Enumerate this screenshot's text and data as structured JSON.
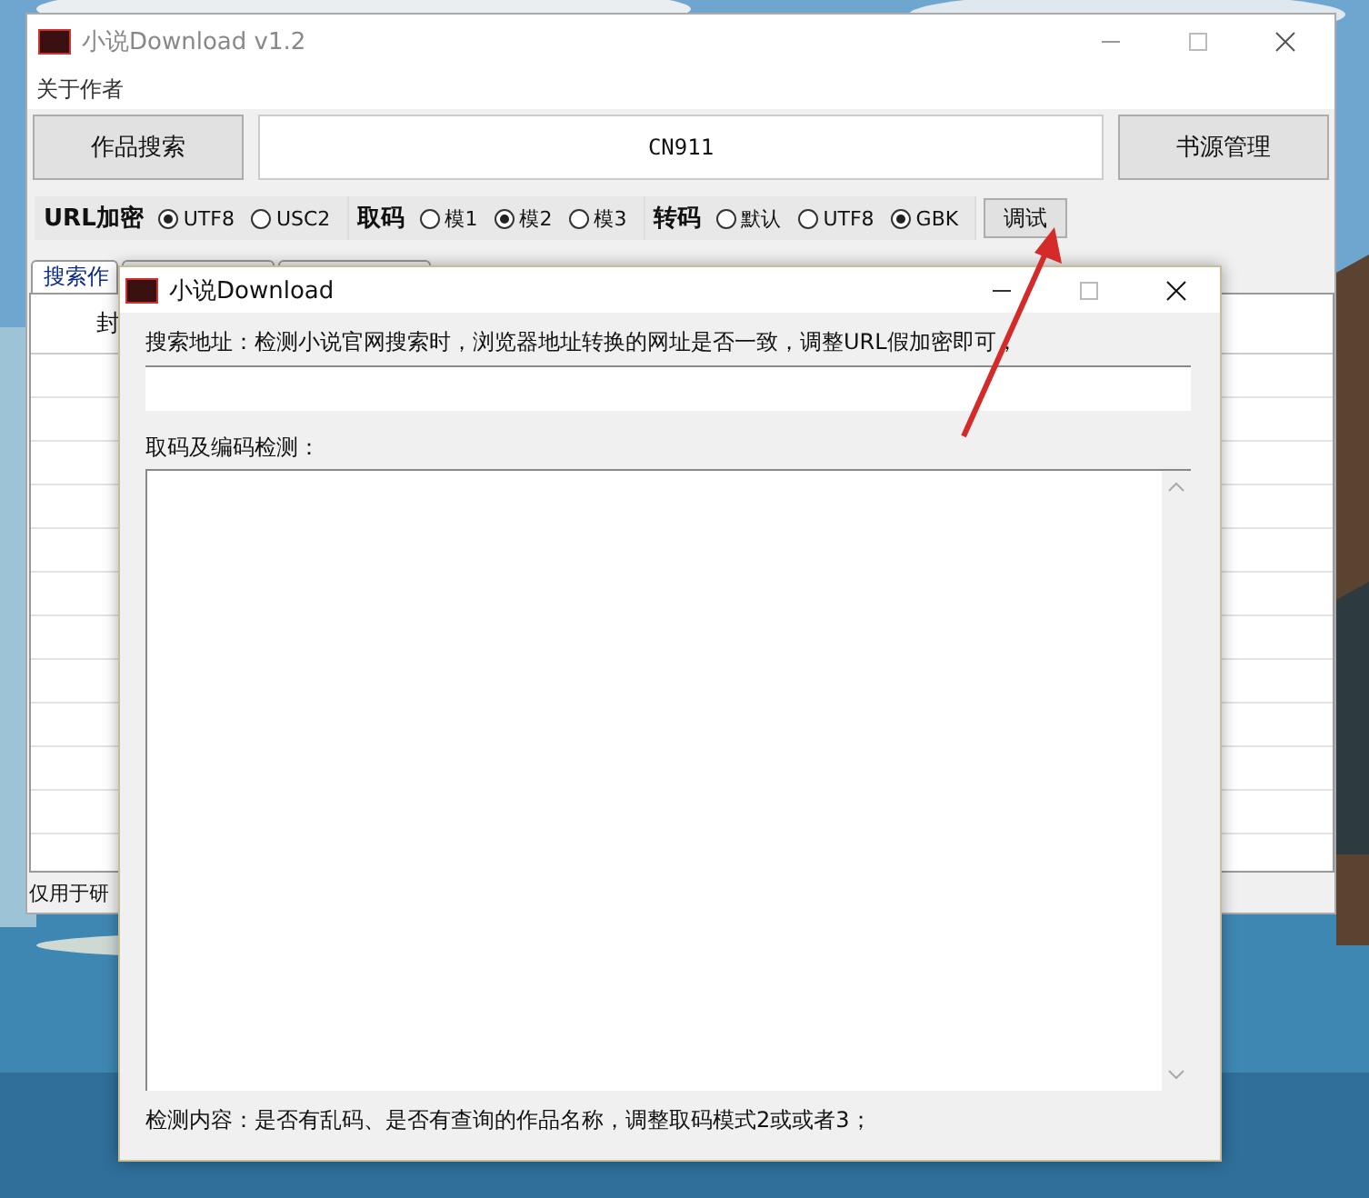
{
  "main_window": {
    "title": "小说Download v1.2",
    "menu": [
      "关于作者"
    ],
    "search_button": "作品搜索",
    "search_field": {
      "value": "CN911"
    },
    "source_button": "书源管理",
    "option_groups": [
      {
        "label": "URL加密",
        "options": [
          {
            "label": "UTF8",
            "selected": true
          },
          {
            "label": "USC2",
            "selected": false
          }
        ]
      },
      {
        "label": "取码",
        "options": [
          {
            "label": "模1",
            "selected": false
          },
          {
            "label": "模2",
            "selected": true
          },
          {
            "label": "模3",
            "selected": false
          }
        ]
      },
      {
        "label": "转码",
        "options": [
          {
            "label": "默认",
            "selected": false
          },
          {
            "label": "UTF8",
            "selected": false
          },
          {
            "label": "GBK",
            "selected": true
          }
        ]
      }
    ],
    "debug_button": "调试",
    "tabs": [
      {
        "label": "搜索作",
        "selected": true
      },
      {
        "selected": false
      },
      {
        "selected": false
      }
    ],
    "column_1": "封",
    "status_bar": "仅用于研"
  },
  "dialog": {
    "title": "小说Download",
    "address_label": "搜索地址：检测小说官网搜索时，浏览器地址转换的网址是否一致，调整URL假加密即可；",
    "encoding_label": "取码及编码检测：",
    "footer": "检测内容：是否有乱码、是否有查询的作品名称，调整取码模式2或或者3；"
  }
}
